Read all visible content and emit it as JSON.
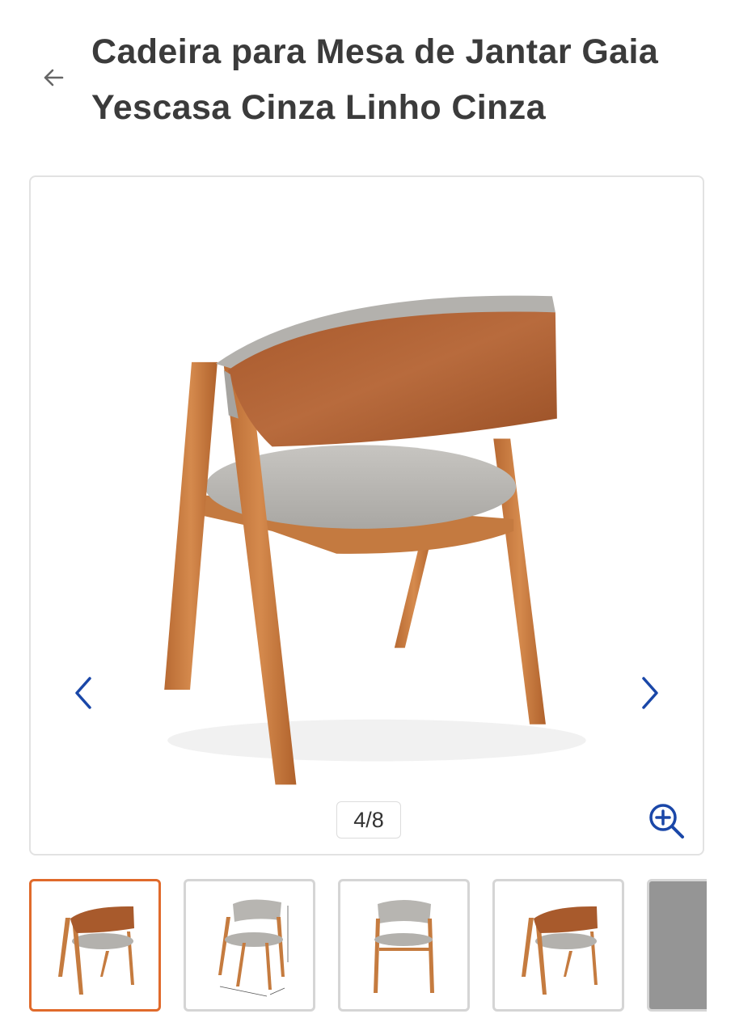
{
  "header": {
    "back_icon": "arrow-left-icon",
    "title": "Cadeira para Mesa de Jantar Gaia Yescasa Cinza Linho Cinza"
  },
  "gallery": {
    "counter": "4/8",
    "current_index": 4,
    "total": 8,
    "prev_icon": "chevron-left-icon",
    "next_icon": "chevron-right-icon",
    "zoom_icon": "zoom-in-icon",
    "accent_color": "#1a47a8"
  },
  "thumbnails": {
    "active_index": 0,
    "active_border_color": "#e06a2b",
    "items": [
      "chair-back-view",
      "chair-front-with-dimensions",
      "chair-front-view",
      "chair-back-view-alt",
      "fabric-swatch"
    ]
  }
}
